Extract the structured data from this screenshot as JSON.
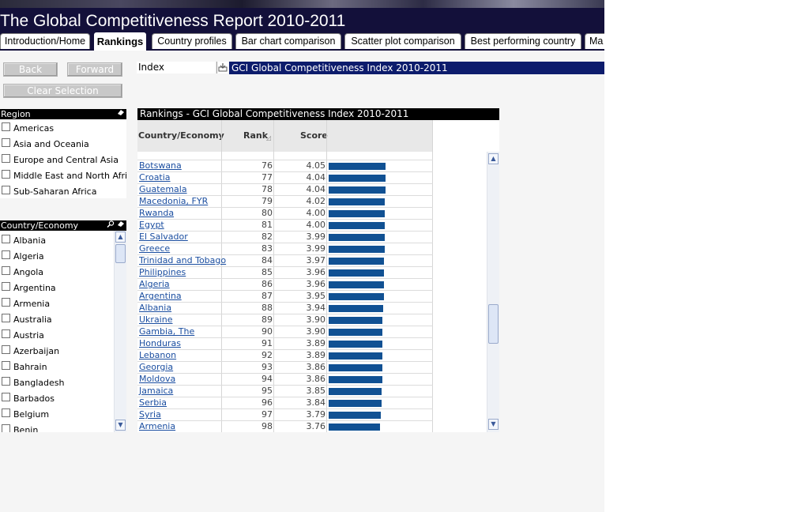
{
  "app": {
    "title": "The Global Competitiveness Report 2010-2011"
  },
  "tabs": [
    {
      "label": "Introduction/Home"
    },
    {
      "label": "Rankings",
      "active": true
    },
    {
      "label": "Country profiles"
    },
    {
      "label": "Bar chart comparison"
    },
    {
      "label": "Scatter plot comparison"
    },
    {
      "label": "Best performing country"
    },
    {
      "label": "Ma"
    }
  ],
  "nav": {
    "back": "Back",
    "forward": "Forward",
    "clear": "Clear Selection"
  },
  "index": {
    "label": "Index",
    "value": "GCI Global Competitiveness Index 2010-2011"
  },
  "region": {
    "header": "Region",
    "items": [
      "Americas",
      "Asia and Oceania",
      "Europe and Central Asia",
      "Middle East and North Africa",
      "Sub-Saharan Africa"
    ]
  },
  "countries": {
    "header": "Country/Economy",
    "items": [
      "Albania",
      "Algeria",
      "Angola",
      "Argentina",
      "Armenia",
      "Australia",
      "Austria",
      "Azerbaijan",
      "Bahrain",
      "Bangladesh",
      "Barbados",
      "Belgium",
      "Benin"
    ]
  },
  "rankings": {
    "title": "Rankings - GCI Global Competitiveness Index 2010-2011",
    "columns": {
      "country": "Country/Economy",
      "rank": "Rank",
      "score": "Score"
    },
    "sort_indicator": "◿",
    "rows": [
      {
        "country": "Botswana",
        "rank": "76",
        "score": "4.05",
        "value": 4.05
      },
      {
        "country": "Croatia",
        "rank": "77",
        "score": "4.04",
        "value": 4.04
      },
      {
        "country": "Guatemala",
        "rank": "78",
        "score": "4.04",
        "value": 4.04
      },
      {
        "country": "Macedonia, FYR",
        "rank": "79",
        "score": "4.02",
        "value": 4.02
      },
      {
        "country": "Rwanda",
        "rank": "80",
        "score": "4.00",
        "value": 4.0
      },
      {
        "country": "Egypt",
        "rank": "81",
        "score": "4.00",
        "value": 4.0
      },
      {
        "country": "El Salvador",
        "rank": "82",
        "score": "3.99",
        "value": 3.99
      },
      {
        "country": "Greece",
        "rank": "83",
        "score": "3.99",
        "value": 3.99
      },
      {
        "country": "Trinidad and Tobago",
        "rank": "84",
        "score": "3.97",
        "value": 3.97
      },
      {
        "country": "Philippines",
        "rank": "85",
        "score": "3.96",
        "value": 3.96
      },
      {
        "country": "Algeria",
        "rank": "86",
        "score": "3.96",
        "value": 3.96
      },
      {
        "country": "Argentina",
        "rank": "87",
        "score": "3.95",
        "value": 3.95
      },
      {
        "country": "Albania",
        "rank": "88",
        "score": "3.94",
        "value": 3.94
      },
      {
        "country": "Ukraine",
        "rank": "89",
        "score": "3.90",
        "value": 3.9
      },
      {
        "country": "Gambia, The",
        "rank": "90",
        "score": "3.90",
        "value": 3.9
      },
      {
        "country": "Honduras",
        "rank": "91",
        "score": "3.89",
        "value": 3.89
      },
      {
        "country": "Lebanon",
        "rank": "92",
        "score": "3.89",
        "value": 3.89
      },
      {
        "country": "Georgia",
        "rank": "93",
        "score": "3.86",
        "value": 3.86
      },
      {
        "country": "Moldova",
        "rank": "94",
        "score": "3.86",
        "value": 3.86
      },
      {
        "country": "Jamaica",
        "rank": "95",
        "score": "3.85",
        "value": 3.85
      },
      {
        "country": "Serbia",
        "rank": "96",
        "score": "3.84",
        "value": 3.84
      },
      {
        "country": "Syria",
        "rank": "97",
        "score": "3.79",
        "value": 3.79
      },
      {
        "country": "Armenia",
        "rank": "98",
        "score": "3.76",
        "value": 3.76
      }
    ]
  },
  "icons": {
    "eraser": "eraser-icon",
    "search": "search-icon",
    "up": "arrow-up-icon",
    "down": "arrow-down-icon",
    "export": "export-icon"
  },
  "colors": {
    "header_bg": "#13103a",
    "index_bg": "#0d1c6c",
    "bar": "#115193",
    "link": "#1b4ea0"
  }
}
